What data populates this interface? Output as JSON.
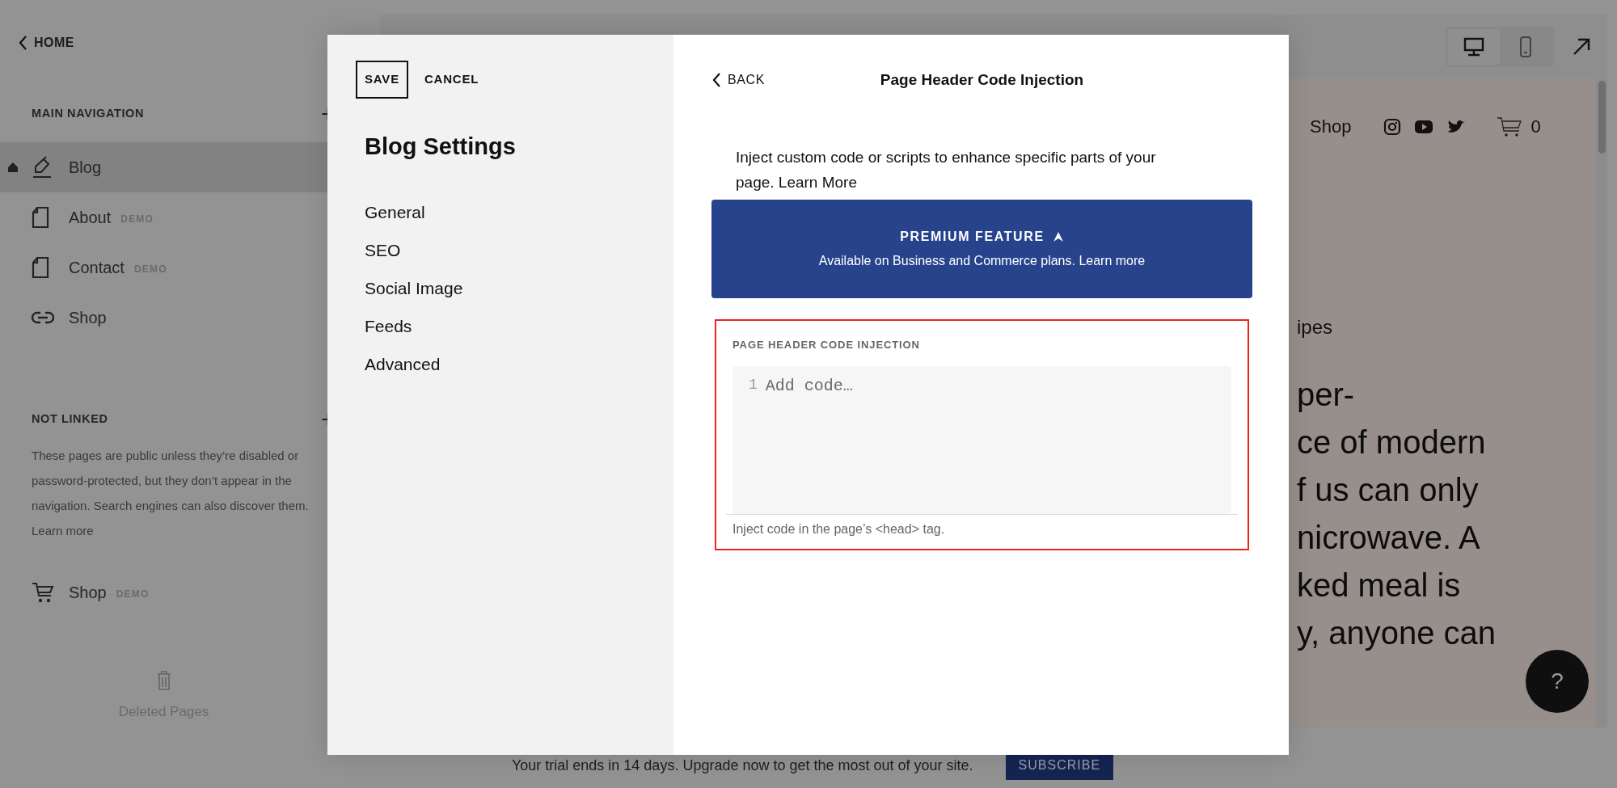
{
  "sidebar": {
    "back": "HOME",
    "sections": [
      {
        "title": "MAIN NAVIGATION",
        "items": [
          {
            "label": "Blog",
            "kind": "blog",
            "home": true,
            "selected": true
          },
          {
            "label": "About",
            "kind": "page",
            "badge": "DEMO",
            "home": false,
            "selected": false
          },
          {
            "label": "Contact",
            "kind": "page",
            "badge": "DEMO",
            "home": false,
            "selected": false
          },
          {
            "label": "Shop",
            "kind": "link",
            "home": false,
            "selected": false
          }
        ]
      },
      {
        "title": "NOT LINKED",
        "note": "These pages are public unless they’re disabled or password-protected, but they don’t appear in the navigation. Search engines can also discover them.",
        "note_link": "Learn more",
        "items": [
          {
            "label": "Shop",
            "kind": "cart",
            "badge": "DEMO",
            "home": false,
            "selected": false
          }
        ]
      }
    ],
    "deleted": "Deleted Pages"
  },
  "preview": {
    "devices": [
      {
        "kind": "desktop",
        "selected": true
      },
      {
        "kind": "mobile",
        "selected": false
      }
    ],
    "nav_link": "Shop",
    "cart_count": "0",
    "heading": "ipes",
    "body_lines": [
      "per-",
      "ce of modern",
      "f us can only",
      "nicrowave. A",
      "ked meal is",
      "y, anyone can"
    ],
    "help": "?"
  },
  "trial": {
    "text": "Your trial ends in 14 days. Upgrade now to get the most out of your site.",
    "button": "SUBSCRIBE"
  },
  "modal": {
    "save": "SAVE",
    "cancel": "CANCEL",
    "title": "Blog Settings",
    "menu": [
      "General",
      "SEO",
      "Social Image",
      "Feeds",
      "Advanced"
    ],
    "back": "BACK",
    "panel_title": "Page Header Code Injection",
    "description": "Inject custom code or scripts to enhance specific parts of your page.",
    "description_link": "Learn More",
    "banner": {
      "title": "PREMIUM FEATURE",
      "text": "Available on Business and Commerce plans.",
      "link": "Learn more"
    },
    "field": {
      "label": "PAGE HEADER CODE INJECTION",
      "line_number": "1",
      "placeholder": "Add code…",
      "hint": "Inject code in the page’s <head> tag.",
      "highlighted": true
    }
  }
}
